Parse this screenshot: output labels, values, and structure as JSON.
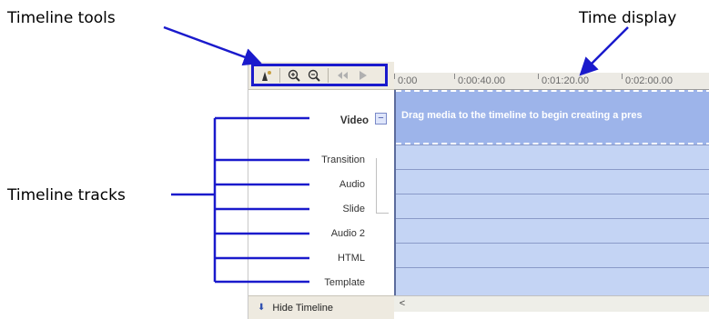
{
  "callouts": {
    "timeline_tools": "Timeline tools",
    "time_display": "Time display",
    "timeline_tracks": "Timeline tracks"
  },
  "ruler": {
    "ticks": [
      "0:00",
      "0:00:40.00",
      "0:01:20.00",
      "0:02:00.00"
    ]
  },
  "tracks": {
    "video": "Video",
    "collapse": "−",
    "transition": "Transition",
    "audio": "Audio",
    "slide": "Slide",
    "audio2": "Audio 2",
    "html": "HTML",
    "template": "Template",
    "video_message": "Drag media to the timeline to begin creating a pres"
  },
  "footer": {
    "hide_timeline": "Hide Timeline",
    "scroll_left": "<"
  },
  "colors": {
    "callout_line": "#1a1acc",
    "track_bg": "#c4d4f4",
    "video_track_bg": "#9db4ea"
  }
}
